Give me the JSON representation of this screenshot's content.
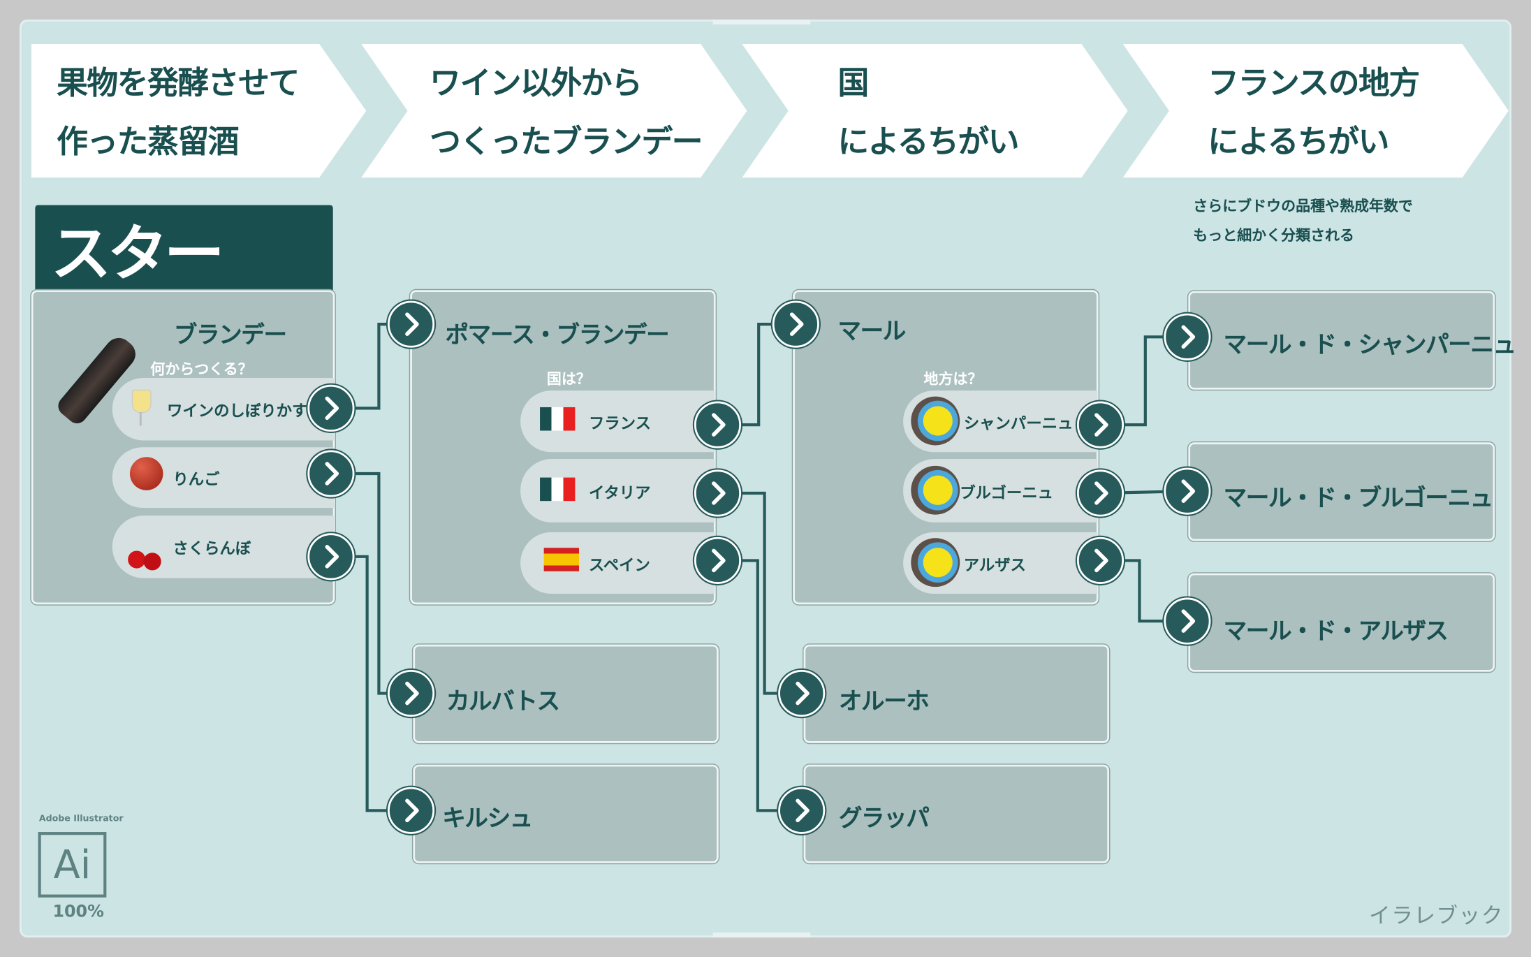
{
  "header": {
    "steps": [
      {
        "line1": "果物を発酵させて",
        "line2": "作った蒸留酒"
      },
      {
        "line1": "ワイン以外から",
        "line2": "つくったブランデー"
      },
      {
        "line1": "国",
        "line2": "によるちがい"
      },
      {
        "line1": "フランスの地方",
        "line2": "によるちがい"
      }
    ],
    "note_line1": "さらにブドウの品種や熟成年数で",
    "note_line2": "もっと細かく分類される"
  },
  "start_label": "スタート！",
  "brandy": {
    "title": "ブランデー",
    "question": "何からつくる？",
    "options": [
      {
        "label": "ワインのしぼりかす",
        "icon": "wine-glass-icon"
      },
      {
        "label": "りんご",
        "icon": "apple-icon"
      },
      {
        "label": "さくらんぼ",
        "icon": "cherry-icon"
      }
    ]
  },
  "pomace": {
    "title": "ポマース・ブランデー",
    "question": "国は？",
    "options": [
      {
        "label": "フランス",
        "icon": "flag-icon"
      },
      {
        "label": "イタリア",
        "icon": "flag-icon"
      },
      {
        "label": "スペイン",
        "icon": "flag-icon"
      }
    ]
  },
  "marc": {
    "title": "マール",
    "question": "地方は？",
    "options": [
      {
        "label": "シャンパーニュ",
        "icon": "france-map-icon"
      },
      {
        "label": "ブルゴーニュ",
        "icon": "france-map-icon"
      },
      {
        "label": "アルザス",
        "icon": "france-map-icon"
      }
    ]
  },
  "results": {
    "calvados": "カルバトス",
    "kirsch": "キルシュ",
    "orujo": "オルーホ",
    "grappa": "グラッパ",
    "champagne": "マール・ド・シャンパーニュ",
    "bourgogne": "マール・ド・ブルゴーニュ",
    "alsace": "マール・ド・アルザス"
  },
  "badge": {
    "label": "Adobe Illustrator",
    "logo": "Ai",
    "zoom": "100%"
  },
  "watermark": "イラレブック",
  "colors": {
    "dark_teal": "#1a4f50",
    "button": "#275a5a",
    "card": "#abc0bf",
    "background": "#cde4e5"
  }
}
